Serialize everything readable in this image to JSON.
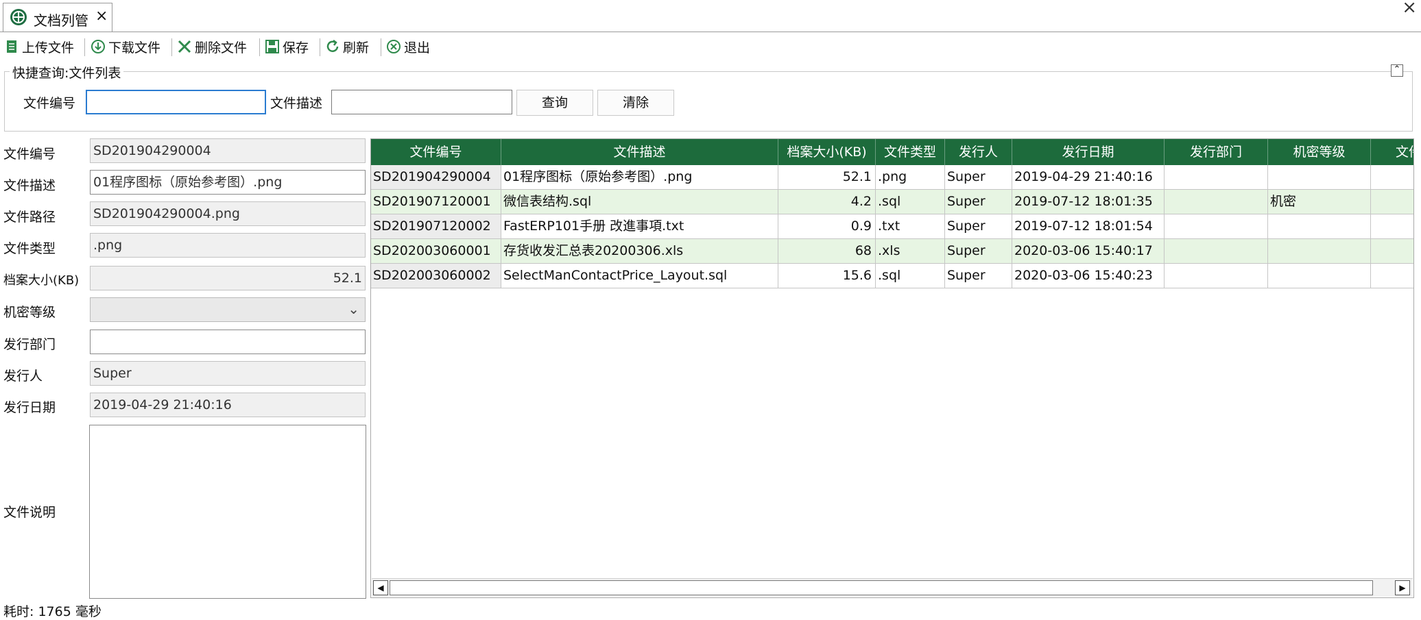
{
  "tab": {
    "title": "文档列管",
    "close": "×"
  },
  "window": {
    "close": "×"
  },
  "toolbar": {
    "upload": "上传文件",
    "download": "下载文件",
    "delete": "删除文件",
    "save": "保存",
    "refresh": "刷新",
    "exit": "退出"
  },
  "quick_search": {
    "legend": "快捷查询:文件列表",
    "collapse": "⌃",
    "file_no_label": "文件编号",
    "file_no_value": "",
    "file_desc_label": "文件描述",
    "file_desc_value": "",
    "query_button": "查询",
    "clear_button": "清除"
  },
  "form": {
    "file_no": {
      "label": "文件编号",
      "value": "SD201904290004"
    },
    "file_desc": {
      "label": "文件描述",
      "value": "01程序图标（原始参考图）.png"
    },
    "file_path": {
      "label": "文件路径",
      "value": "SD201904290004.png"
    },
    "file_type": {
      "label": "文件类型",
      "value": ".png"
    },
    "file_size": {
      "label": "档案大小(KB)",
      "value": "52.1"
    },
    "security": {
      "label": "机密等级",
      "value": ""
    },
    "dept": {
      "label": "发行部门",
      "value": ""
    },
    "issuer": {
      "label": "发行人",
      "value": "Super"
    },
    "issue_date": {
      "label": "发行日期",
      "value": "2019-04-29 21:40:16"
    },
    "notes": {
      "label": "文件说明",
      "value": ""
    }
  },
  "grid": {
    "columns": [
      "文件编号",
      "文件描述",
      "档案大小(KB)",
      "文件类型",
      "发行人",
      "发行日期",
      "发行部门",
      "机密等级",
      "文件"
    ],
    "rows": [
      [
        "SD201904290004",
        "01程序图标（原始参考图）.png",
        "52.1",
        ".png",
        "Super",
        "2019-04-29 21:40:16",
        "",
        "",
        ""
      ],
      [
        "SD201907120001",
        "微信表结构.sql",
        "4.2",
        ".sql",
        "Super",
        "2019-07-12 18:01:35",
        "",
        "机密",
        ""
      ],
      [
        "SD201907120002",
        "FastERP101手册 改進事項.txt",
        "0.9",
        ".txt",
        "Super",
        "2019-07-12 18:01:54",
        "",
        "",
        ""
      ],
      [
        "SD202003060001",
        "存货收发汇总表20200306.xls",
        "68",
        ".xls",
        "Super",
        "2020-03-06 15:40:17",
        "",
        "",
        ""
      ],
      [
        "SD202003060002",
        "SelectManContactPrice_Layout.sql",
        "15.6",
        ".sql",
        "Super",
        "2020-03-06 15:40:23",
        "",
        "",
        ""
      ]
    ]
  },
  "status": {
    "text": "耗时: 1765 毫秒"
  },
  "colors": {
    "header_green": "#1d6b3c",
    "row_alt": "#e7f5e3",
    "focus_blue": "#2a7bd0"
  }
}
